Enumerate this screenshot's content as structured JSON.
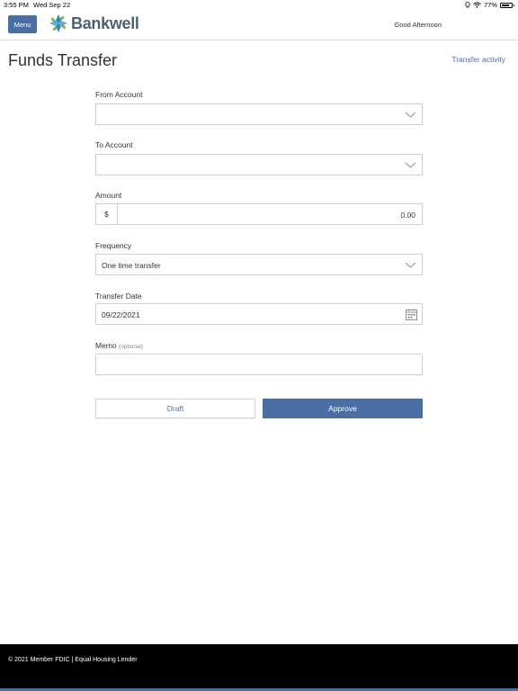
{
  "statusbar": {
    "time": "3:55 PM",
    "date": "Wed Sep 22",
    "battery": "77%"
  },
  "header": {
    "menu_label": "Menu",
    "logo_text": "Bankwell",
    "greeting": "Good Afternoon"
  },
  "page": {
    "title": "Funds Transfer",
    "activity_link": "Transfer activity"
  },
  "form": {
    "from_label": "From Account",
    "from_value": "",
    "to_label": "To Account",
    "to_value": "",
    "amount_label": "Amount",
    "currency_symbol": "$",
    "amount_value": "0.00",
    "frequency_label": "Frequency",
    "frequency_value": "One time transfer",
    "date_label": "Transfer Date",
    "date_value": "09/22/2021",
    "memo_label": "Memo",
    "memo_optional": "(optional)",
    "memo_value": ""
  },
  "buttons": {
    "draft": "Draft",
    "approve": "Approve"
  },
  "footer": {
    "text": "© 2021  Member FDIC |  Equal Housing Lender"
  },
  "colors": {
    "accent": "#4a6fa5",
    "logo_text": "#4d5f73",
    "footer_bg": "#000000"
  },
  "icons": {
    "dropdown": "chevron-down-icon",
    "calendar": "calendar-icon",
    "wifi": "wifi-icon",
    "battery": "battery-icon",
    "location": "location-icon"
  }
}
